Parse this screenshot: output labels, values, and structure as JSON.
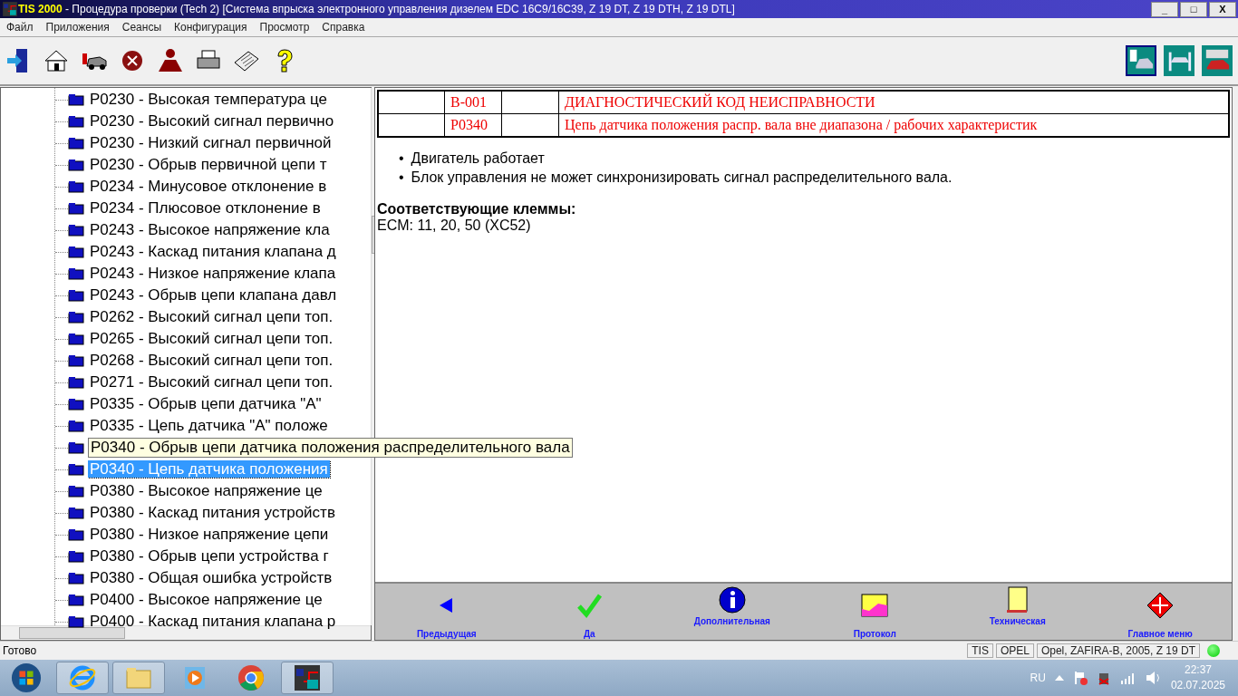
{
  "window": {
    "app": "TIS 2000",
    "title": " - Процедура проверки (Tech 2) [Система впрыска электронного управления дизелем EDC 16C9/16C39, Z 19 DT, Z 19 DTH, Z 19 DTL]",
    "controls": [
      "_",
      "□",
      "X"
    ]
  },
  "menu": [
    "Файл",
    "Приложения",
    "Сеансы",
    "Конфигурация",
    "Просмотр",
    "Справка"
  ],
  "toolbar": [
    {
      "kind": "exit"
    },
    {
      "kind": "home"
    },
    {
      "kind": "car"
    },
    {
      "kind": "stop"
    },
    {
      "kind": "person"
    },
    {
      "kind": "print"
    },
    {
      "kind": "news"
    },
    {
      "kind": "help"
    }
  ],
  "toolbar_right": [
    {
      "kind": "list",
      "selected": true
    },
    {
      "kind": "lift",
      "selected": false
    },
    {
      "kind": "redcar",
      "selected": false
    }
  ],
  "tree": [
    {
      "label": "P0230 - Высокая температура це",
      "selected": false
    },
    {
      "label": "P0230 - Высокий сигнал первично",
      "selected": false
    },
    {
      "label": "P0230 - Низкий сигнал первичной",
      "selected": false
    },
    {
      "label": "P0230 - Обрыв первичной цепи т",
      "selected": false
    },
    {
      "label": "P0234 - Минусовое отклонение в",
      "selected": false
    },
    {
      "label": "P0234 - Плюсовое отклонение в",
      "selected": false
    },
    {
      "label": "P0243 - Высокое напряжение кла",
      "selected": false
    },
    {
      "label": "P0243 - Каскад питания клапана д",
      "selected": false
    },
    {
      "label": "P0243 - Низкое напряжение клапа",
      "selected": false
    },
    {
      "label": "P0243 - Обрыв цепи клапана давл",
      "selected": false
    },
    {
      "label": "P0262 - Высокий сигнал цепи топ.",
      "selected": false
    },
    {
      "label": "P0265 - Высокий сигнал цепи топ.",
      "selected": false
    },
    {
      "label": "P0268 - Высокий сигнал цепи топ.",
      "selected": false
    },
    {
      "label": "P0271 - Высокий сигнал цепи топ.",
      "selected": false
    },
    {
      "label": "P0335 - Обрыв цепи датчика \"A\"",
      "selected": false
    },
    {
      "label": "P0335 - Цепь датчика \"A\" положе",
      "selected": false
    },
    {
      "label": "P0340 - Обрыв цепи датчика положения распределительного вала",
      "selected": false,
      "kind": "tooltip"
    },
    {
      "label": "P0340 - Цепь датчика положения",
      "selected": true
    },
    {
      "label": "P0380 - Высокое напряжение це",
      "selected": false
    },
    {
      "label": "P0380 - Каскад питания устройств",
      "selected": false
    },
    {
      "label": "P0380 - Низкое напряжение цепи",
      "selected": false
    },
    {
      "label": "P0380 - Обрыв цепи устройства г",
      "selected": false
    },
    {
      "label": "P0380 - Общая ошибка устройств",
      "selected": false
    },
    {
      "label": "P0400 - Высокое напряжение це",
      "selected": false
    },
    {
      "label": "P0400 - Каскад питания клапана р",
      "selected": false
    }
  ],
  "header_table": [
    [
      "B-001",
      "ДИАГНОСТИЧЕСКИЙ КОД НЕИСПРАВНОСТИ"
    ],
    [
      "P0340",
      "Цепь датчика положения распр. вала вне диапазона / рабочих характеристик"
    ]
  ],
  "bullets": [
    {
      "marker": "•",
      "text": "Двигатель работает"
    },
    {
      "marker": "•",
      "text": "Блок управления не может синхронизировать сигнал распределительного вала."
    }
  ],
  "terminals": {
    "heading": "Соответствующие клеммы:",
    "text": "ECM: 11, 20, 50 (XC52)"
  },
  "nav": [
    {
      "kind": "prev",
      "label": "Предыдущая"
    },
    {
      "kind": "yes",
      "label": "Да"
    },
    {
      "kind": "info",
      "label": "Дополнительная"
    },
    {
      "kind": "log",
      "label": "Протокол"
    },
    {
      "kind": "tech",
      "label": "Техническая"
    },
    {
      "kind": "main",
      "label": "Главное меню"
    }
  ],
  "status": {
    "text": "Готово",
    "cells": [
      "TIS",
      "OPEL",
      "Opel, ZAFIRA-B, 2005, Z 19 DT"
    ]
  },
  "taskbar": {
    "apps": [
      {
        "kind": "ie"
      },
      {
        "kind": "folder"
      },
      {
        "kind": "media"
      },
      {
        "kind": "chrome"
      },
      {
        "kind": "tis"
      }
    ],
    "lang": "RU",
    "time": "22:37",
    "date": "02.07.2025"
  }
}
